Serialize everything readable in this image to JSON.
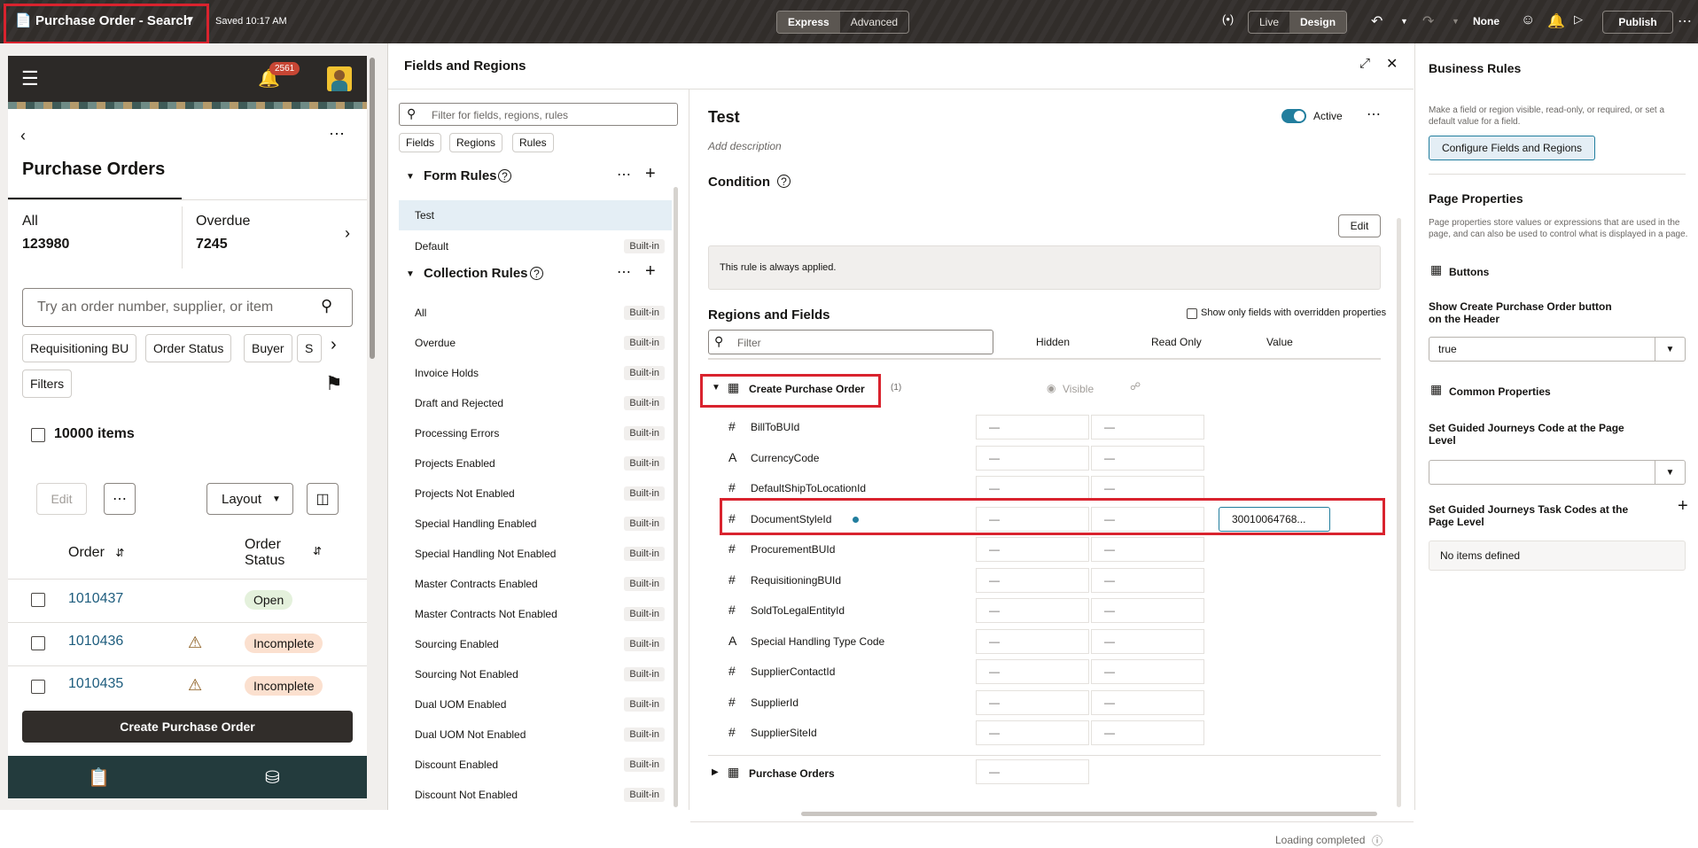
{
  "topbar": {
    "title": "Purchase Order - Search",
    "saved": "Saved 10:17 AM",
    "mode_express": "Express",
    "mode_advanced": "Advanced",
    "live": "Live",
    "design": "Design",
    "none": "None",
    "publish": "Publish"
  },
  "preview": {
    "notif_count": "2561",
    "page_title": "Purchase Orders",
    "tabs": [
      {
        "label": "All",
        "count": "123980"
      },
      {
        "label": "Overdue",
        "count": "7245"
      }
    ],
    "search_placeholder": "Try an order number, supplier, or item",
    "chips": [
      "Requisitioning BU",
      "Order Status",
      "Buyer",
      "S"
    ],
    "filters": "Filters",
    "items_count": "10000 items",
    "edit": "Edit",
    "layout": "Layout",
    "col_order": "Order",
    "col_status": "Order Status",
    "rows": [
      {
        "order": "1010437",
        "status": "Open"
      },
      {
        "order": "1010436",
        "status": "Incomplete"
      },
      {
        "order": "1010435",
        "status": "Incomplete"
      }
    ],
    "create_button": "Create Purchase Order"
  },
  "fields_panel": {
    "title": "Fields and Regions",
    "filter_placeholder": "Filter for fields, regions, rules",
    "tabs": [
      "Fields",
      "Regions",
      "Rules"
    ],
    "form_rules_label": "Form Rules",
    "form_rules": [
      {
        "name": "Test",
        "builtin": ""
      },
      {
        "name": "Default",
        "builtin": "Built-in"
      }
    ],
    "collection_rules_label": "Collection Rules",
    "collection_rules": [
      {
        "name": "All",
        "builtin": "Built-in"
      },
      {
        "name": "Overdue",
        "builtin": "Built-in"
      },
      {
        "name": "Invoice Holds",
        "builtin": "Built-in"
      },
      {
        "name": "Draft and Rejected",
        "builtin": "Built-in"
      },
      {
        "name": "Processing Errors",
        "builtin": "Built-in"
      },
      {
        "name": "Projects Enabled",
        "builtin": "Built-in"
      },
      {
        "name": "Projects Not Enabled",
        "builtin": "Built-in"
      },
      {
        "name": "Special Handling Enabled",
        "builtin": "Built-in"
      },
      {
        "name": "Special Handling Not Enabled",
        "builtin": "Built-in"
      },
      {
        "name": "Master Contracts Enabled",
        "builtin": "Built-in"
      },
      {
        "name": "Master Contracts Not Enabled",
        "builtin": "Built-in"
      },
      {
        "name": "Sourcing Enabled",
        "builtin": "Built-in"
      },
      {
        "name": "Sourcing Not Enabled",
        "builtin": "Built-in"
      },
      {
        "name": "Dual UOM Enabled",
        "builtin": "Built-in"
      },
      {
        "name": "Dual UOM Not Enabled",
        "builtin": "Built-in"
      },
      {
        "name": "Discount Enabled",
        "builtin": "Built-in"
      },
      {
        "name": "Discount Not Enabled",
        "builtin": "Built-in"
      }
    ],
    "rule_title": "Test",
    "active": "Active",
    "add_description": "Add description",
    "condition_label": "Condition",
    "edit": "Edit",
    "condition_text": "This rule is always applied.",
    "regions_fields_label": "Regions and Fields",
    "show_overridden": "Show only fields with overridden properties",
    "filter": "Filter",
    "col_hidden": "Hidden",
    "col_readonly": "Read Only",
    "col_value": "Value",
    "region_name": "Create Purchase Order",
    "region_count": "(1)",
    "visible": "Visible",
    "dash": "—",
    "fields": [
      {
        "icon": "#",
        "name": "BillToBUId"
      },
      {
        "icon": "A",
        "name": "CurrencyCode"
      },
      {
        "icon": "#",
        "name": "DefaultShipToLocationId"
      },
      {
        "icon": "#",
        "name": "DocumentStyleId",
        "value": "30010064768..."
      },
      {
        "icon": "#",
        "name": "ProcurementBUId"
      },
      {
        "icon": "#",
        "name": "RequisitioningBUId"
      },
      {
        "icon": "#",
        "name": "SoldToLegalEntityId"
      },
      {
        "icon": "A",
        "name": "Special Handling Type Code"
      },
      {
        "icon": "#",
        "name": "SupplierContactId"
      },
      {
        "icon": "#",
        "name": "SupplierId"
      },
      {
        "icon": "#",
        "name": "SupplierSiteId"
      }
    ],
    "region2_name": "Purchase Orders",
    "loading": "Loading completed"
  },
  "business_rules": {
    "title": "Business Rules",
    "desc": "Make a field or region visible, read-only, or required, or set a default value for a field.",
    "configure": "Configure Fields and Regions",
    "page_props": "Page Properties",
    "page_props_desc": "Page properties store values or expressions that are used in the page, and can also be used to control what is displayed in a page.",
    "buttons": "Buttons",
    "show_create": "Show Create Purchase Order button on the Header",
    "show_create_value": "true",
    "common": "Common Properties",
    "guided_code": "Set Guided Journeys Code at the Page Level",
    "guided_task": "Set Guided Journeys Task Codes at the Page Level",
    "no_items": "No items defined"
  }
}
